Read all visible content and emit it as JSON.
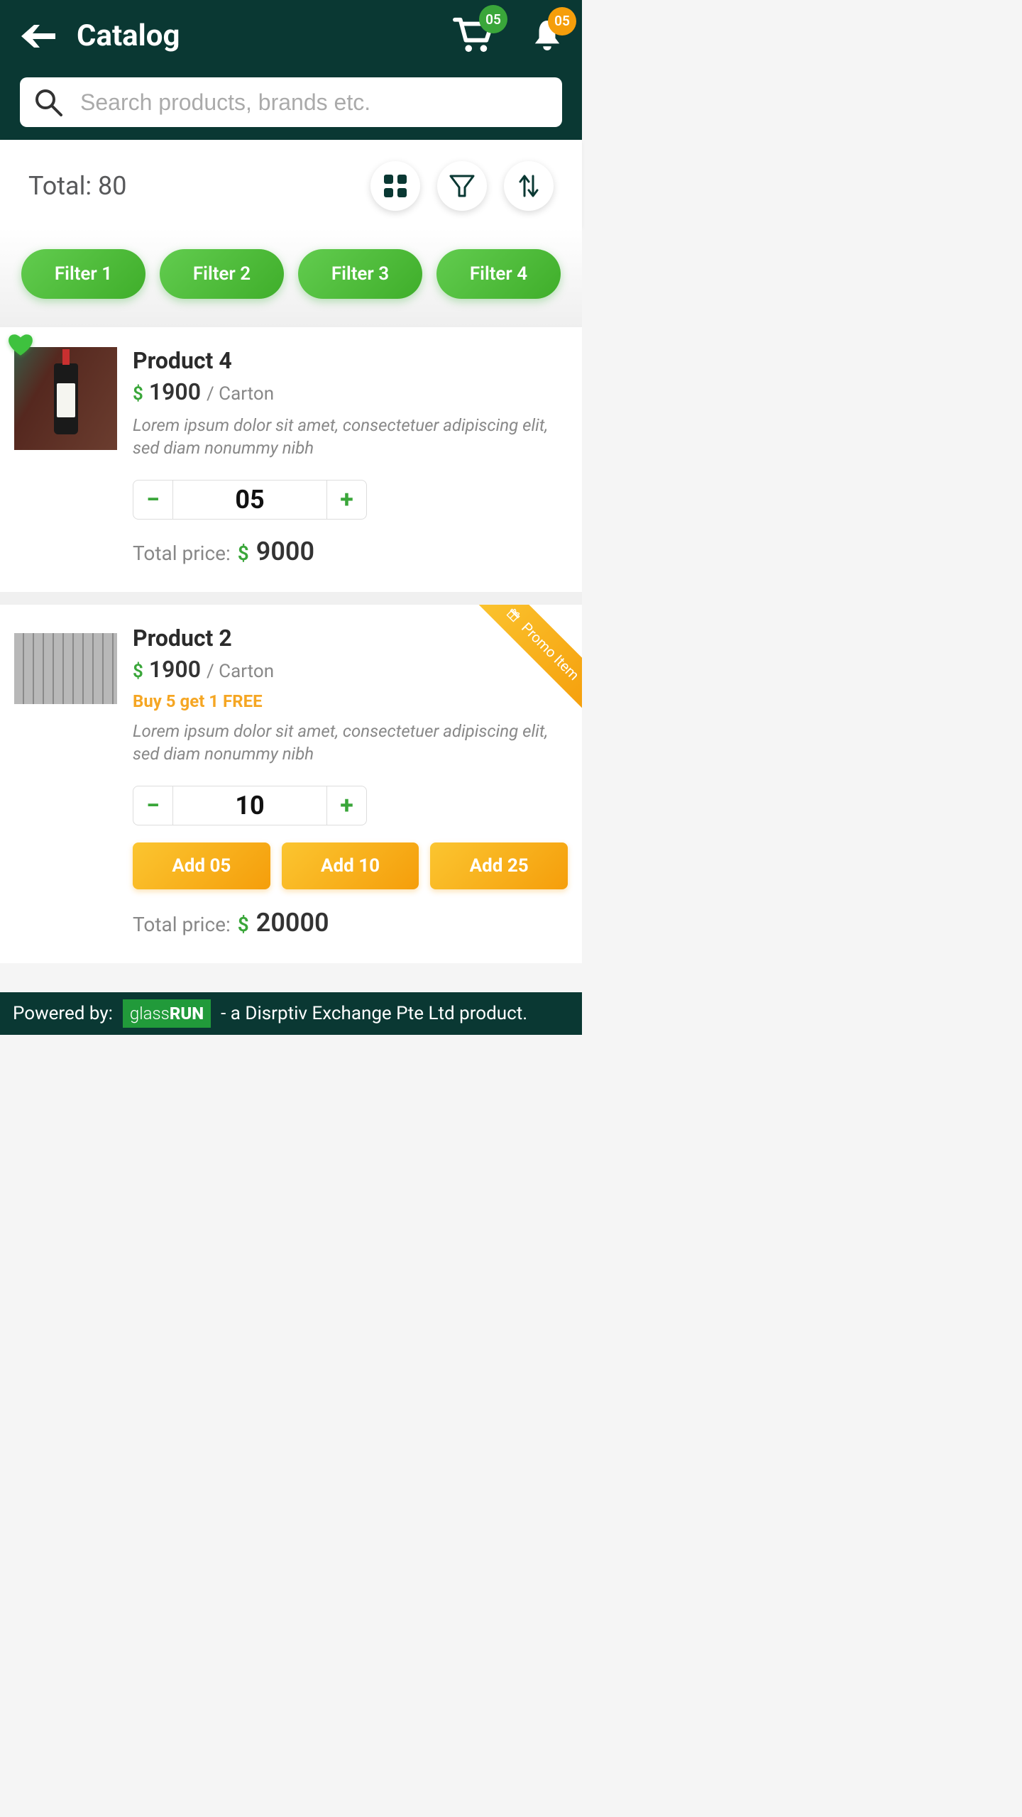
{
  "header": {
    "title": "Catalog",
    "cart_badge": "05",
    "notif_badge": "05",
    "search_placeholder": "Search products, brands etc."
  },
  "controls": {
    "total_label": "Total: 80"
  },
  "filters": [
    "Filter 1",
    "Filter 2",
    "Filter 3",
    "Filter 4"
  ],
  "products": [
    {
      "name": "Product 4",
      "currency": "$",
      "price": "1900",
      "unit": "/ Carton",
      "description": "Lorem ipsum dolor sit amet, consectetuer adipiscing elit, sed diam nonummy nibh",
      "qty": "05",
      "total_label": "Total price:",
      "total_currency": "$",
      "total": "9000"
    },
    {
      "name": "Product 2",
      "currency": "$",
      "price": "1900",
      "unit": "/ Carton",
      "promo_text": "Buy 5 get 1 FREE",
      "description": "Lorem ipsum dolor sit amet, consectetuer adipiscing elit, sed diam nonummy nibh",
      "qty": "10",
      "add_buttons": [
        "Add 05",
        "Add 10",
        "Add 25"
      ],
      "total_label": "Total price:",
      "total_currency": "$",
      "total": "20000",
      "ribbon": "Promo Item"
    }
  ],
  "footer": {
    "powered": "Powered by:",
    "logo_thin": "glass",
    "logo_bold": "RUN",
    "tagline": "- a Disrptiv Exchange Pte Ltd product."
  }
}
